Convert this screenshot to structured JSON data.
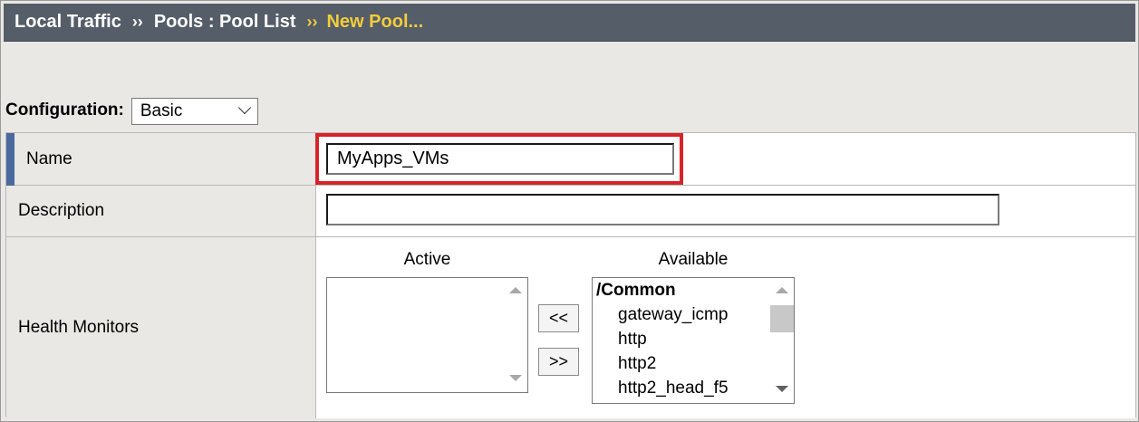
{
  "breadcrumb": {
    "items": [
      "Local Traffic",
      "Pools : Pool List"
    ],
    "separator": "››",
    "current": "New Pool..."
  },
  "configuration": {
    "label": "Configuration:",
    "selected": "Basic"
  },
  "form": {
    "name": {
      "label": "Name",
      "value": "MyApps_VMs"
    },
    "description": {
      "label": "Description",
      "value": ""
    },
    "health_monitors": {
      "label": "Health Monitors",
      "active_heading": "Active",
      "available_heading": "Available",
      "active_items": [],
      "available_group": "/Common",
      "available_items": [
        "gateway_icmp",
        "http",
        "http2",
        "http2_head_f5"
      ],
      "move_left_label": "<<",
      "move_right_label": ">>"
    }
  },
  "colors": {
    "header_bg": "#555d69",
    "current_crumb": "#f2cd3a",
    "highlight": "#d8232a",
    "accent": "#4a6a9f"
  }
}
